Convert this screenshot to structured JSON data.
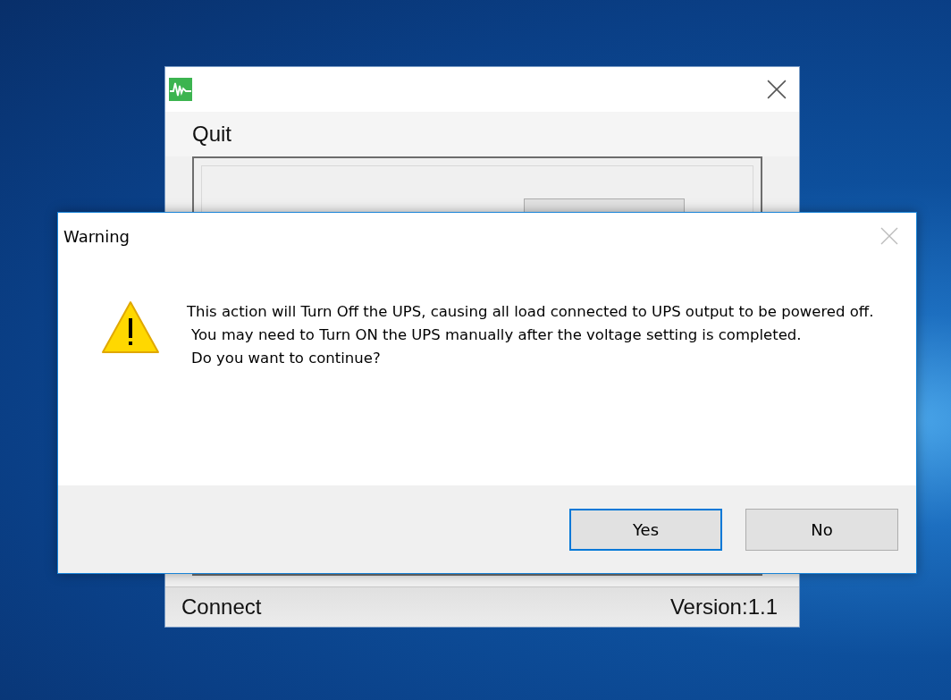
{
  "app_window": {
    "menu": [
      "Quit"
    ],
    "status_bar": {
      "left": "Connect",
      "right": "Version:1.1"
    }
  },
  "dialog": {
    "title": "Warning",
    "message": [
      "This action will Turn Off the UPS, causing all load connected to UPS output to be powered off.",
      "You may need to Turn ON the UPS manually after the voltage setting is completed.",
      "Do you want to continue?"
    ],
    "buttons": [
      {
        "label": "Yes",
        "default": true
      },
      {
        "label": "No",
        "default": false
      }
    ]
  }
}
